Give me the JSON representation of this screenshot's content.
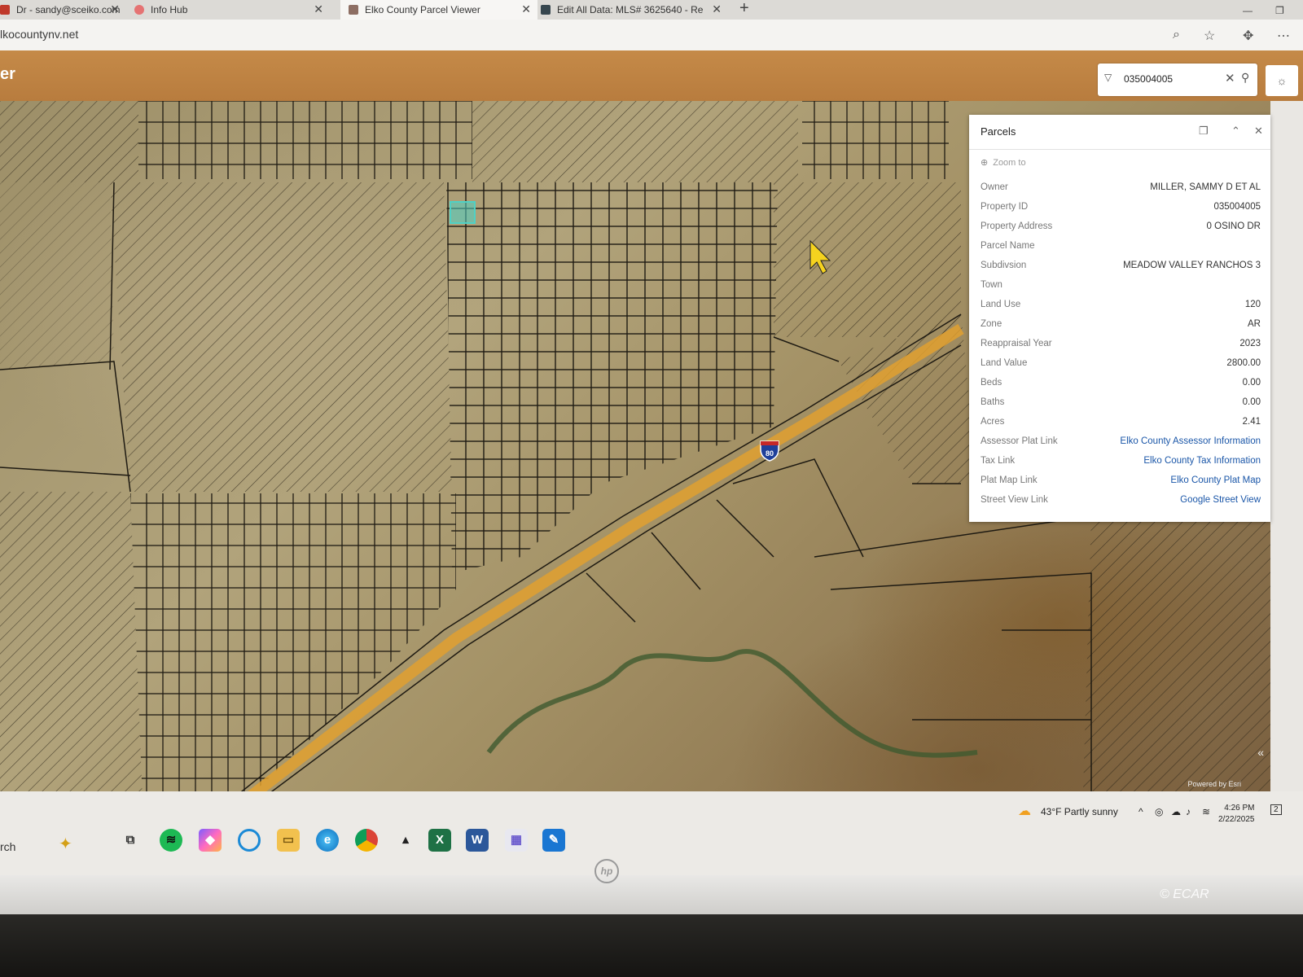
{
  "browser": {
    "tabs": [
      {
        "label": "Dr - sandy@sceiko.com",
        "icon": "mail-icon",
        "active": false
      },
      {
        "label": "Info Hub",
        "icon": "hub-icon",
        "active": false
      },
      {
        "label": "Elko County Parcel Viewer",
        "icon": "map-icon",
        "active": true
      },
      {
        "label": "Edit All Data: MLS# 3625640 - Re",
        "icon": "mls-icon",
        "active": false
      }
    ],
    "new_tab": "+",
    "url": "lkocountynv.net"
  },
  "app": {
    "title": "er",
    "search": {
      "value": "035004005"
    }
  },
  "panel": {
    "title": "Parcels",
    "zoom_to": "Zoom to",
    "rows": [
      {
        "label": "Owner",
        "value": "MILLER, SAMMY D ET AL",
        "link": false
      },
      {
        "label": "Property ID",
        "value": "035004005",
        "link": false
      },
      {
        "label": "Property Address",
        "value": "0 OSINO DR",
        "link": false
      },
      {
        "label": "Parcel Name",
        "value": "",
        "link": false
      },
      {
        "label": "Subdivsion",
        "value": "MEADOW VALLEY RANCHOS 3",
        "link": false
      },
      {
        "label": "Town",
        "value": "",
        "link": false
      },
      {
        "label": "Land Use",
        "value": "120",
        "link": false
      },
      {
        "label": "Zone",
        "value": "AR",
        "link": false
      },
      {
        "label": "Reappraisal Year",
        "value": "2023",
        "link": false
      },
      {
        "label": "Land Value",
        "value": "2800.00",
        "link": false
      },
      {
        "label": "Beds",
        "value": "0.00",
        "link": false
      },
      {
        "label": "Baths",
        "value": "0.00",
        "link": false
      },
      {
        "label": "Acres",
        "value": "2.41",
        "link": false
      },
      {
        "label": "Assessor Plat Link",
        "value": "Elko County Assessor Information",
        "link": true
      },
      {
        "label": "Tax Link",
        "value": "Elko County Tax Information",
        "link": true
      },
      {
        "label": "Plat Map Link",
        "value": "Elko County Plat Map",
        "link": true
      },
      {
        "label": "Street View Link",
        "value": "Google Street View",
        "link": true
      }
    ]
  },
  "map": {
    "highway_shield": "80",
    "attribution": "Powered by Esri"
  },
  "taskbar": {
    "search_label": "rch",
    "weather": "43°F Partly sunny",
    "time": "4:26 PM",
    "date": "2/22/2025",
    "notifications": "2"
  },
  "watermark": "© ECAR",
  "colors": {
    "header": "#b87c3e",
    "link": "#1a56a8",
    "selection": "#4fd1c5",
    "highway": "#e0a030"
  }
}
